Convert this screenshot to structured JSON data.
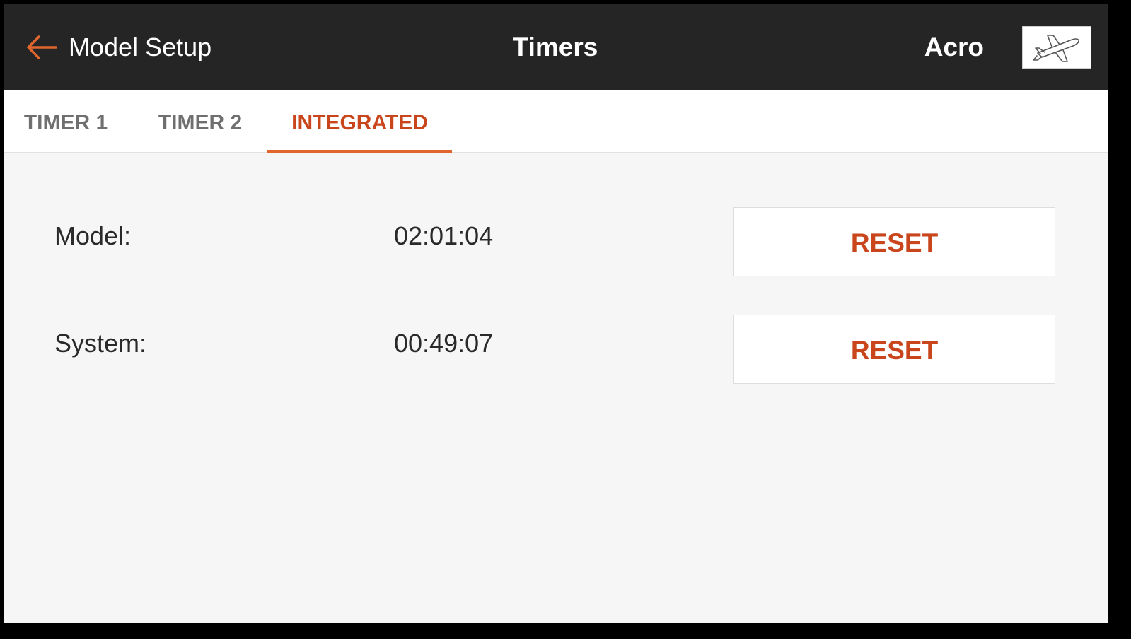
{
  "header": {
    "back_label": "Model Setup",
    "back_icon": "arrow-left-icon",
    "title": "Timers",
    "model_name": "Acro",
    "model_icon": "airplane-icon"
  },
  "tabs": [
    {
      "label": "TIMER 1",
      "active": false
    },
    {
      "label": "TIMER 2",
      "active": false
    },
    {
      "label": "INTEGRATED",
      "active": true
    }
  ],
  "rows": [
    {
      "label": "Model:",
      "value": "02:01:04",
      "button": "RESET"
    },
    {
      "label": "System:",
      "value": "00:49:07",
      "button": "RESET"
    }
  ],
  "colors": {
    "header_bg": "#252525",
    "accent": "#e0662e",
    "accent_text": "#c9461c",
    "content_bg": "#f6f6f6",
    "inactive_tab": "#6f6f6f"
  }
}
